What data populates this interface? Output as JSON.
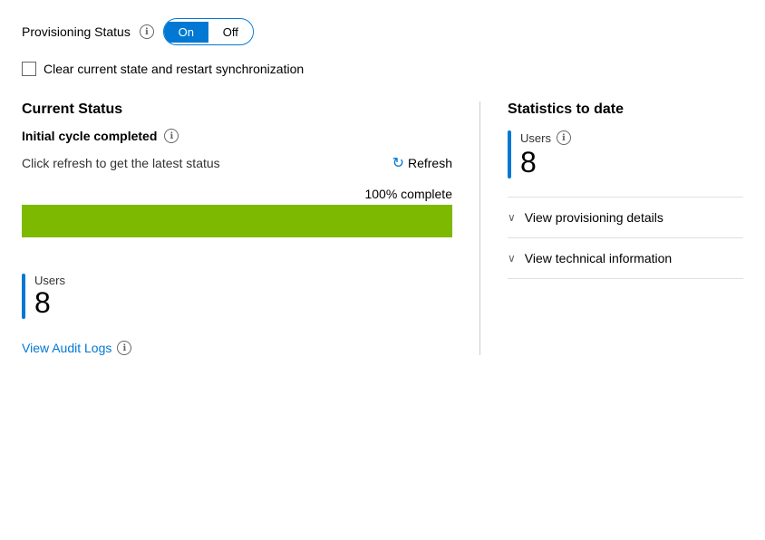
{
  "provisioning": {
    "label": "Provisioning Status",
    "info_icon": "ℹ",
    "toggle": {
      "on_label": "On",
      "off_label": "Off",
      "state": "on"
    }
  },
  "checkbox": {
    "label": "Clear current state and restart synchronization"
  },
  "current_status": {
    "title": "Current Status",
    "cycle_label": "Initial cycle completed",
    "info_icon": "ℹ",
    "refresh_hint": "Click refresh to get the latest status",
    "refresh_label": "Refresh",
    "progress_percent": "100% complete",
    "progress_value": 100
  },
  "left_stats": {
    "users_label": "Users",
    "users_count": "8"
  },
  "audit": {
    "link_label": "View Audit Logs",
    "info_icon": "ℹ"
  },
  "right_panel": {
    "title": "Statistics to date",
    "users_label": "Users",
    "users_info": "ℹ",
    "users_count": "8",
    "expand_items": [
      {
        "label": "View provisioning details",
        "chevron": "∨"
      },
      {
        "label": "View technical information",
        "chevron": "∨"
      }
    ]
  }
}
